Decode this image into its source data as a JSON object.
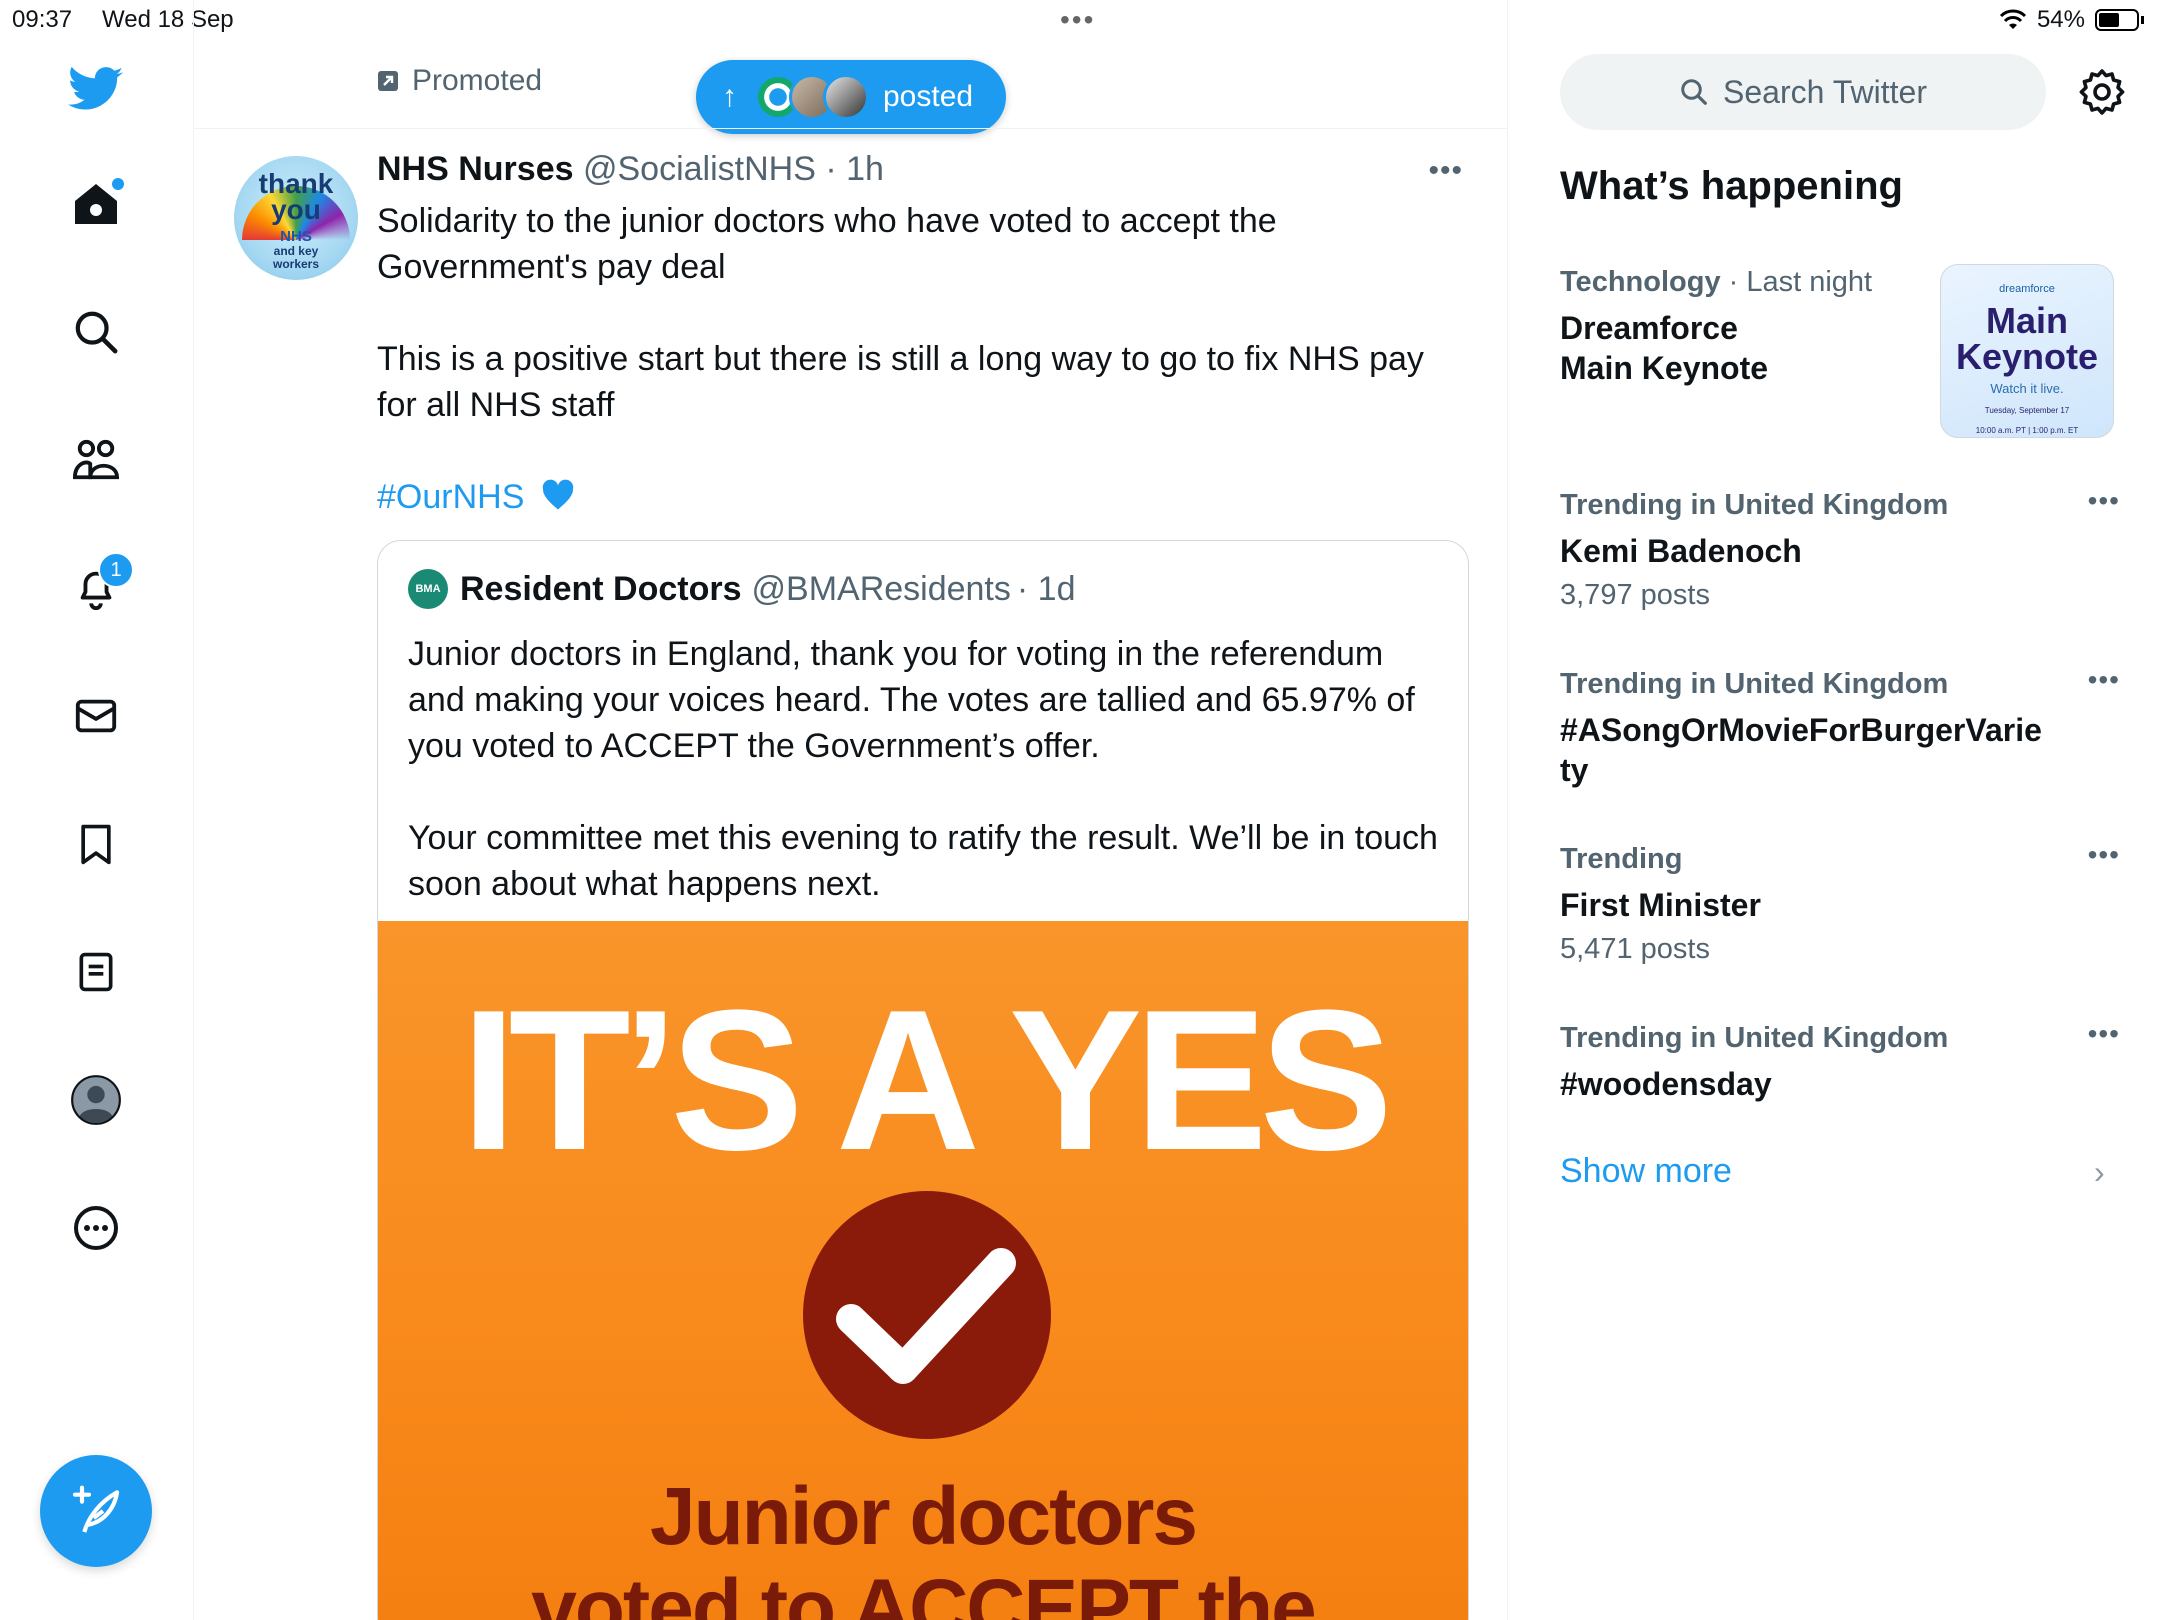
{
  "status_bar": {
    "time": "09:37",
    "date": "Wed 18 Sep",
    "battery": "54%"
  },
  "nav": {
    "items": [
      "Twitter",
      "Home",
      "Explore",
      "Communities",
      "Notifications",
      "Messages",
      "Bookmarks",
      "Lists",
      "Profile",
      "More"
    ],
    "notifications_badge": "1"
  },
  "feed": {
    "promoted_label": "Promoted",
    "new_posts_pill": "posted",
    "tweet": {
      "avatar_lines": [
        "thank",
        "you",
        "NHS",
        "and key",
        "workers"
      ],
      "name": "NHS Nurses",
      "handle": "@SocialistNHS",
      "time": "· 1h",
      "paragraphs": [
        "Solidarity to the junior doctors who have voted to accept the Government's pay deal",
        "This is a positive start but there is still a long way to go to fix NHS pay for all NHS staff"
      ],
      "hashtag": "#OurNHS",
      "quote": {
        "avatar_text": "BMA",
        "name": "Resident Doctors",
        "handle": "@BMAResidents",
        "time": "· 1d",
        "paragraphs": [
          "Junior doctors in England, thank you for voting in the referendum and making your voices heard. The votes are tallied and 65.97% of you voted to ACCEPT the Government’s offer.",
          "Your committee met this evening to ratify the result. We’ll be in touch soon about what happens next."
        ],
        "image": {
          "headline": "IT’S A YES",
          "sub_line1": "Junior doctors",
          "sub_line2": "voted to ACCEPT the"
        }
      }
    }
  },
  "sidebar": {
    "search_placeholder": "Search Twitter",
    "section_title": "What’s happening",
    "trends": [
      {
        "category": "Technology",
        "time": " · Last night",
        "title_line1": "Dreamforce",
        "title_line2": "Main Keynote",
        "image": {
          "brand": "dreamforce",
          "title_line1": "Main",
          "title_line2": "Keynote",
          "sub": "Watch it live.",
          "date_line1": "Tuesday, September 17",
          "date_line2": "10:00 a.m. PT | 1:00 p.m. ET"
        }
      },
      {
        "category": "Trending in United Kingdom",
        "title": "Kemi Badenoch",
        "posts": "3,797 posts"
      },
      {
        "category": "Trending in United Kingdom",
        "title_line1": "#ASongOrMovieForBurgerVarie",
        "title_line2": "ty"
      },
      {
        "category": "Trending",
        "title": "First Minister",
        "posts": "5,471 posts"
      },
      {
        "category": "Trending in United Kingdom",
        "title": "#woodensday"
      }
    ],
    "show_more": "Show more"
  },
  "colors": {
    "accent": "#1d9bf0",
    "text": "#0f1419",
    "secondary": "#536471",
    "image_orange": "#f98a1c",
    "check_circle": "#8a1a0a"
  }
}
